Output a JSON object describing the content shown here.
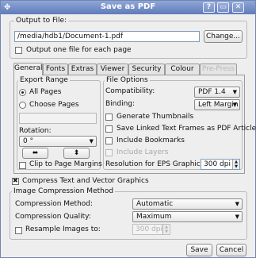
{
  "window": {
    "title": "Save as PDF",
    "help": "?",
    "minimize": "▭",
    "close": "✕"
  },
  "output": {
    "legend": "Output to File:",
    "path": "/media/hdb1/Document-1.pdf",
    "change_label": "Change...",
    "one_file_label": "Output one file for each page"
  },
  "tabs": [
    "General",
    "Fonts",
    "Extras",
    "Viewer",
    "Security",
    "Colour",
    "Pre-Press"
  ],
  "export_range": {
    "legend": "Export Range",
    "all_pages": "All Pages",
    "choose_pages": "Choose Pages",
    "rotation_label": "Rotation:",
    "rotation_value": "0 °",
    "flip_h": "⬌",
    "flip_v": "⬍",
    "clip_label": "Clip to Page Margins"
  },
  "file_options": {
    "legend": "File Options",
    "compat_label": "Compatibility:",
    "compat_value": "PDF 1.4",
    "binding_label": "Binding:",
    "binding_value": "Left Margin",
    "thumbnails": "Generate Thumbnails",
    "linked_frames": "Save Linked Text Frames as PDF Articles",
    "bookmarks": "Include Bookmarks",
    "layers": "Include Layers",
    "eps_res_label": "Resolution for EPS Graphics:",
    "eps_res_value": "300 dpi"
  },
  "compress_text": "Compress Text and Vector Graphics",
  "image_compression": {
    "legend": "Image Compression Method",
    "method_label": "Compression Method:",
    "method_value": "Automatic",
    "quality_label": "Compression Quality:",
    "quality_value": "Maximum",
    "resample_label": "Resample Images to:",
    "resample_value": "300 dpi"
  },
  "save_label": "Save",
  "cancel_label": "Cancel"
}
